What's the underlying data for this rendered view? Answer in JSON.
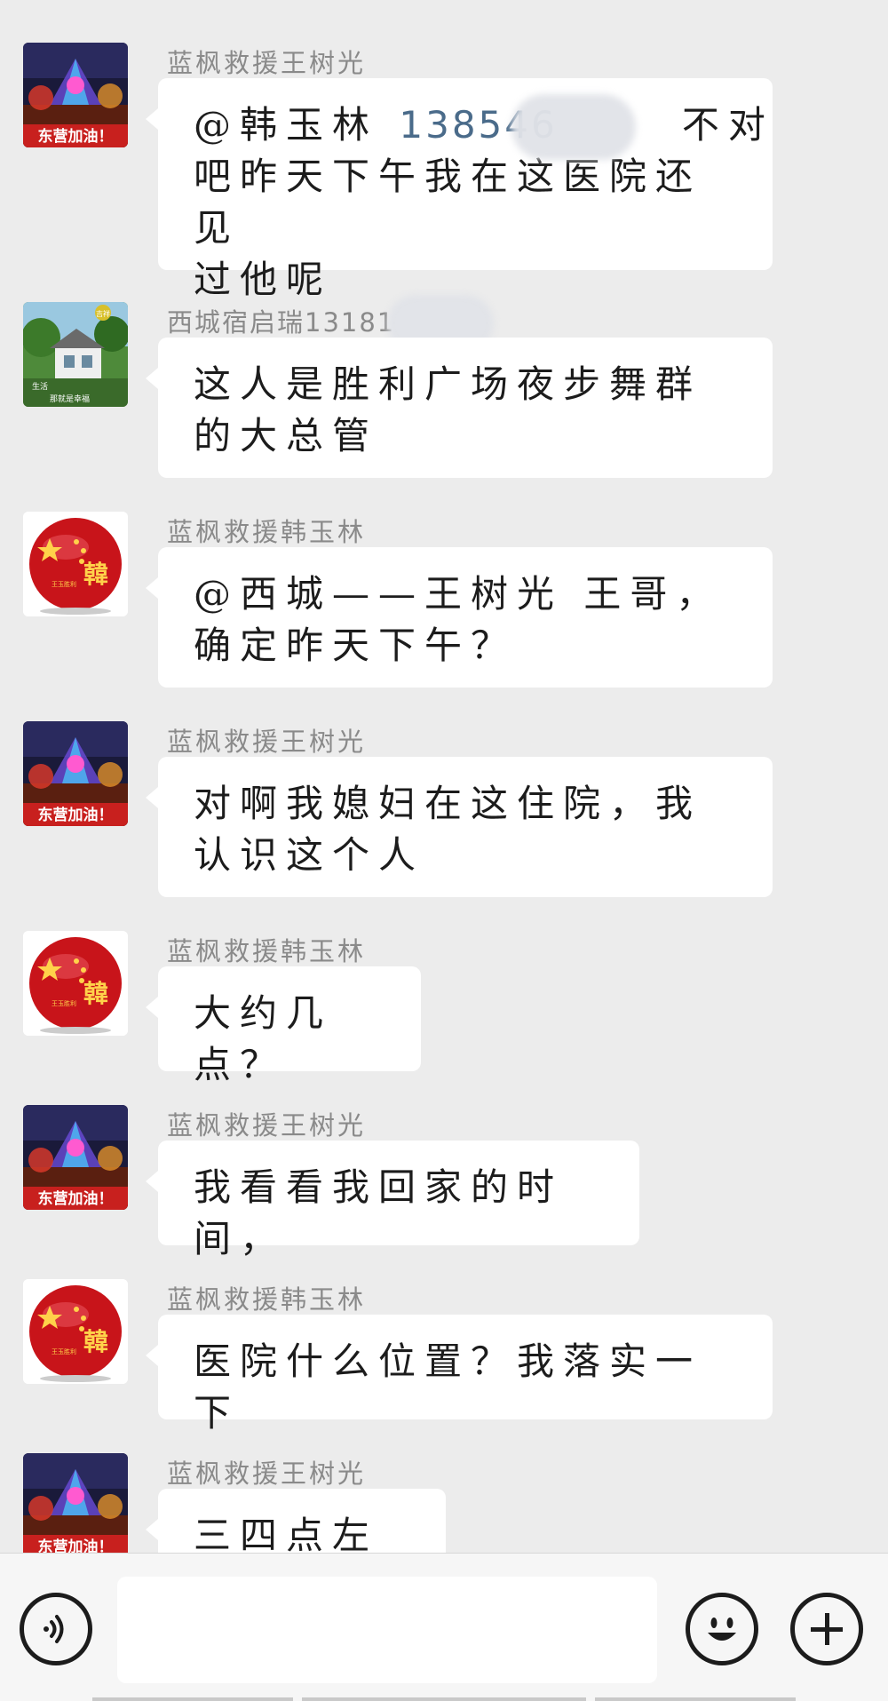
{
  "messages": [
    {
      "sender": "蓝枫救援王树光",
      "avatar": "fireworks-donggying-avatar",
      "text_parts": {
        "mention": "@韩玉林",
        "phone": "138546",
        "rest_line1": "不对",
        "line2": "吧昨天下午我在这医院还见",
        "line3": "过他呢"
      }
    },
    {
      "sender": "西城宿启瑞13181",
      "avatar": "house-garden-avatar",
      "text": "这人是胜利广场夜步舞群的大总管"
    },
    {
      "sender": "蓝枫救援韩玉林",
      "avatar": "red-star-orb-avatar",
      "text": "@西城——王树光 王哥，确定昨天下午？"
    },
    {
      "sender": "蓝枫救援王树光",
      "avatar": "fireworks-donggying-avatar",
      "text": "对啊我媳妇在这住院，我认识这个人"
    },
    {
      "sender": "蓝枫救援韩玉林",
      "avatar": "red-star-orb-avatar",
      "text": "大约几点？"
    },
    {
      "sender": "蓝枫救援王树光",
      "avatar": "fireworks-donggying-avatar",
      "text": "我看看我回家的时间，"
    },
    {
      "sender": "蓝枫救援韩玉林",
      "avatar": "red-star-orb-avatar",
      "text": "医院什么位置？我落实一下"
    },
    {
      "sender": "蓝枫救援王树光",
      "avatar": "fireworks-donggying-avatar",
      "text": "三四点左右"
    }
  ],
  "avatar_texts": {
    "fireworks_banner": "东营加油！",
    "orb_char": "韓",
    "orb_small": "王玉胜利",
    "house_corner": "吉祥",
    "house_caption1": "生活",
    "house_caption2": "那就是幸福"
  },
  "input_bar": {
    "voice_icon": "voice-icon",
    "emoji_icon": "emoji-icon",
    "plus_icon": "plus-icon",
    "input_value": ""
  },
  "colors": {
    "background": "#ececec",
    "bubble": "#ffffff",
    "sender": "#8a8a8a",
    "phone": "#4a6b8a"
  }
}
